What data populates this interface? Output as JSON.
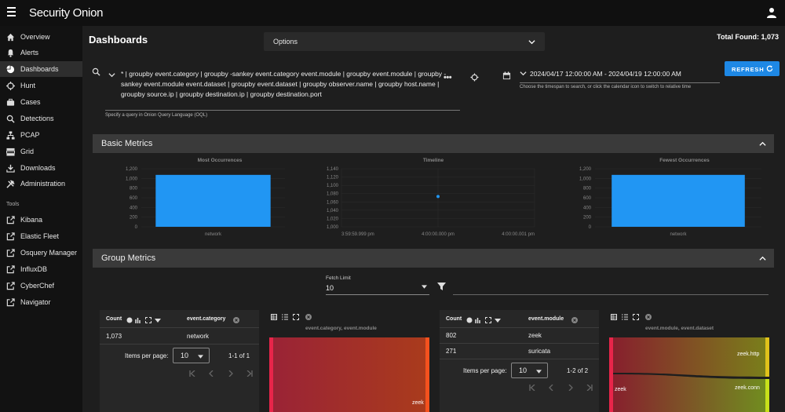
{
  "app": {
    "brand": "Security Onion"
  },
  "sidebar": {
    "items": [
      {
        "label": "Overview",
        "icon": "home-icon"
      },
      {
        "label": "Alerts",
        "icon": "bell-icon"
      },
      {
        "label": "Dashboards",
        "icon": "pie-chart-icon",
        "active": true
      },
      {
        "label": "Hunt",
        "icon": "crosshairs-icon"
      },
      {
        "label": "Cases",
        "icon": "briefcase-icon"
      },
      {
        "label": "Detections",
        "icon": "search-icon"
      },
      {
        "label": "PCAP",
        "icon": "network-icon"
      },
      {
        "label": "Grid",
        "icon": "grid-icon"
      },
      {
        "label": "Downloads",
        "icon": "download-icon"
      },
      {
        "label": "Administration",
        "icon": "tools-icon"
      }
    ],
    "tools_heading": "Tools",
    "tools": [
      {
        "label": "Kibana",
        "icon": "external-link-icon"
      },
      {
        "label": "Elastic Fleet",
        "icon": "external-link-icon"
      },
      {
        "label": "Osquery Manager",
        "icon": "external-link-icon"
      },
      {
        "label": "InfluxDB",
        "icon": "external-link-icon"
      },
      {
        "label": "CyberChef",
        "icon": "external-link-icon"
      },
      {
        "label": "Navigator",
        "icon": "external-link-icon"
      }
    ]
  },
  "header": {
    "title": "Dashboards",
    "options_label": "Options",
    "total_found": "Total Found: 1,073"
  },
  "query": {
    "text": "* | groupby event.category | groupby -sankey event.category event.module | groupby event.module | groupby -sankey event.module event.dataset | groupby event.dataset | groupby observer.name | groupby host.name | groupby source.ip | groupby destination.ip | groupby destination.port",
    "hint": "Specify a query in Onion Query Language (OQL)",
    "more": "•••"
  },
  "daterange": {
    "value": "2024/04/17 12:00:00 AM - 2024/04/19 12:00:00 AM",
    "hint": "Choose the timespan to search, or click the calendar icon to switch to relative time"
  },
  "refresh_label": "REFRESH",
  "basic_metrics": {
    "title": "Basic Metrics",
    "most": {
      "title": "Most Occurrences",
      "ticks": [
        "1,200",
        "1,000",
        "800",
        "600",
        "400",
        "200",
        "0"
      ],
      "category": "network"
    },
    "timeline": {
      "title": "Timeline",
      "ticks": [
        "1,140",
        "1,120",
        "1,100",
        "1,080",
        "1,060",
        "1,040",
        "1,020",
        "1,000"
      ],
      "xticks": [
        "3:59:59.999 pm",
        "4:00:00.000 pm",
        "4:00:00.001 pm"
      ]
    },
    "fewest": {
      "title": "Fewest Occurrences",
      "ticks": [
        "1,200",
        "1,000",
        "800",
        "600",
        "400",
        "200",
        "0"
      ],
      "category": "network"
    }
  },
  "chart_data": [
    {
      "type": "bar",
      "title": "Most Occurrences",
      "categories": [
        "network"
      ],
      "values": [
        1073
      ],
      "ylim": [
        0,
        1200
      ],
      "color": "#2196f3"
    },
    {
      "type": "scatter",
      "title": "Timeline",
      "x": [
        "4:00:00.000 pm"
      ],
      "values": [
        1073
      ],
      "ylim": [
        1000,
        1140
      ],
      "color": "#2196f3"
    },
    {
      "type": "bar",
      "title": "Fewest Occurrences",
      "categories": [
        "network"
      ],
      "values": [
        1073
      ],
      "ylim": [
        0,
        1200
      ],
      "color": "#2196f3"
    }
  ],
  "group_metrics": {
    "title": "Group Metrics",
    "fetch_limit_label": "Fetch Limit",
    "fetch_limit_value": "10",
    "table1": {
      "count_header": "Count",
      "field_header": "event.category",
      "rows": [
        {
          "count": "1,073",
          "value": "network"
        }
      ],
      "items_per_page_label": "Items per page:",
      "items_per_page": "10",
      "range": "1-1 of 1"
    },
    "sankey1": {
      "title": "event.category, event.module",
      "node": "zeek"
    },
    "table2": {
      "count_header": "Count",
      "field_header": "event.module",
      "rows": [
        {
          "count": "802",
          "value": "zeek"
        },
        {
          "count": "271",
          "value": "suricata"
        }
      ],
      "items_per_page_label": "Items per page:",
      "items_per_page": "10",
      "range": "1-2 of 2"
    },
    "sankey2": {
      "title": "event.module, event.dataset",
      "nodes": [
        "zeek",
        "zeek.http",
        "zeek.conn"
      ]
    }
  },
  "colors": {
    "accent": "#1e88e5",
    "bar": "#2196f3"
  }
}
